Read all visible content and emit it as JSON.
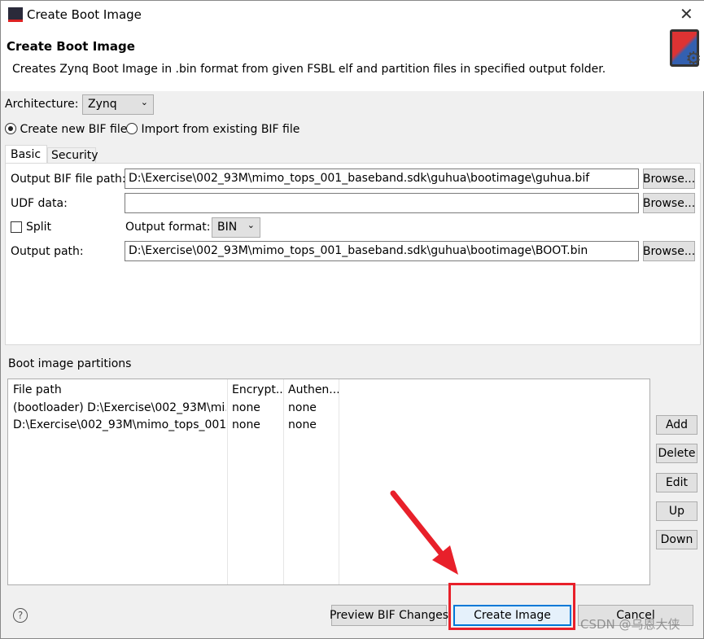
{
  "window": {
    "title": "Create Boot Image",
    "app_icon": "SDK"
  },
  "header": {
    "title": "Create Boot Image",
    "description": "Creates Zynq Boot Image in .bin format from given FSBL elf and partition files in specified output folder."
  },
  "architecture": {
    "label": "Architecture:",
    "value": "Zynq"
  },
  "bif_mode": {
    "options": [
      {
        "label": "Create new BIF file",
        "selected": true
      },
      {
        "label": "Import from existing BIF file",
        "selected": false
      }
    ]
  },
  "tabs": [
    {
      "label": "Basic",
      "active": true
    },
    {
      "label": "Security",
      "active": false
    }
  ],
  "basic": {
    "output_bif_label": "Output BIF file path:",
    "output_bif_value": "D:\\Exercise\\002_93M\\mimo_tops_001_baseband.sdk\\guhua\\bootimage\\guhua.bif",
    "udf_label": "UDF data:",
    "udf_value": "",
    "split_label": "Split",
    "split_checked": false,
    "output_format_label": "Output format:",
    "output_format_value": "BIN",
    "output_path_label": "Output path:",
    "output_path_value": "D:\\Exercise\\002_93M\\mimo_tops_001_baseband.sdk\\guhua\\bootimage\\BOOT.bin",
    "browse_label": "Browse..."
  },
  "partitions": {
    "label": "Boot image partitions",
    "columns": [
      "File path",
      "Encrypt...",
      "Authen..."
    ],
    "rows": [
      [
        "(bootloader) D:\\Exercise\\002_93M\\mi...",
        "none",
        "none"
      ],
      [
        "D:\\Exercise\\002_93M\\mimo_tops_001...",
        "none",
        "none"
      ]
    ],
    "buttons": [
      "Add",
      "Delete",
      "Edit",
      "Up",
      "Down"
    ]
  },
  "footer": {
    "preview": "Preview BIF Changes",
    "create": "Create Image",
    "cancel": "Cancel"
  },
  "annotation": {
    "color": "#e8202a"
  },
  "watermark": "CSDN @乌恩大侠"
}
